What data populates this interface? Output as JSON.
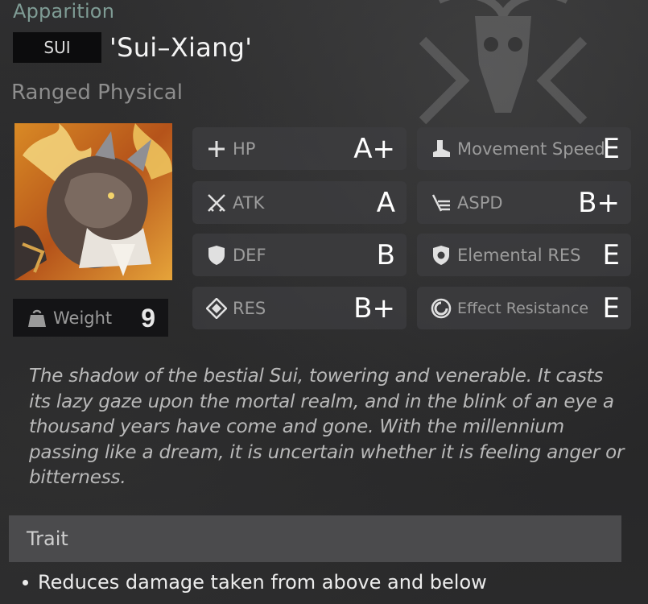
{
  "unit": {
    "category": "Apparition",
    "tag": "SUI",
    "name": "'Sui–Xiang'",
    "type": "Ranged Physical"
  },
  "weight": {
    "label": "Weight",
    "value": "9",
    "icon": "weight-icon"
  },
  "stats": [
    {
      "label": "HP",
      "grade": "A+",
      "icon": "plus-icon"
    },
    {
      "label": "Movement Speed",
      "grade": "E",
      "icon": "boot-icon"
    },
    {
      "label": "ATK",
      "grade": "A",
      "icon": "crossed-swords-icon"
    },
    {
      "label": "ASPD",
      "grade": "B+",
      "icon": "speed-lines-icon"
    },
    {
      "label": "DEF",
      "grade": "B",
      "icon": "shield-icon"
    },
    {
      "label": "Elemental RES",
      "grade": "E",
      "icon": "elemental-shield-icon"
    },
    {
      "label": "RES",
      "grade": "B+",
      "icon": "diamond-icon"
    },
    {
      "label": "Effect Resistance",
      "grade": "E",
      "icon": "ring-icon"
    }
  ],
  "description": "The shadow of the bestial Sui, towering and venerable. It casts its lazy gaze upon the mortal realm, and in the blink of an eye a thousand years have come and gone. With the millennium passing like a dream, it is uncertain whether it is feeling anger or bitterness.",
  "trait": {
    "header": "Trait",
    "items": [
      "Reduces damage taken from above and below"
    ]
  },
  "colors": {
    "category": "#7f9c95",
    "panel": "#3e3e40",
    "trait_header": "#4b4b4d"
  }
}
